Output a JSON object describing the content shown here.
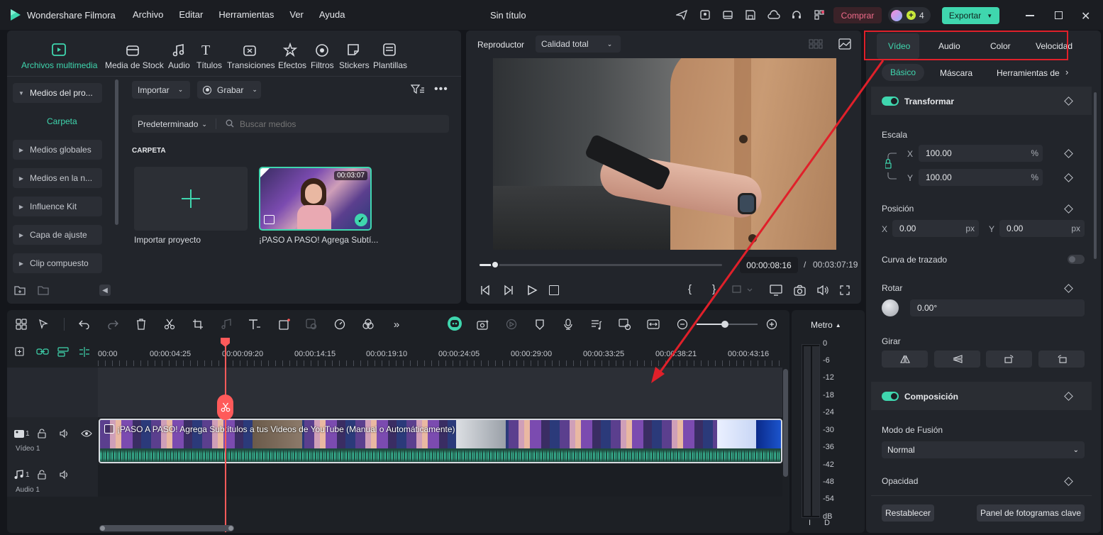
{
  "app": {
    "name": "Wondershare Filmora",
    "project_title": "Sin título"
  },
  "menu": [
    "Archivo",
    "Editar",
    "Herramientas",
    "Ver",
    "Ayuda"
  ],
  "titlebar": {
    "buy_label": "Comprar",
    "credits": "4",
    "export_label": "Exportar"
  },
  "media_tabs": [
    "Archivos multimedia",
    "Media de Stock",
    "Audio",
    "Títulos",
    "Transiciones",
    "Efectos",
    "Filtros",
    "Stickers",
    "Plantillas"
  ],
  "sidebar": {
    "project_media": "Medios del pro...",
    "folder": "Carpeta",
    "items": [
      "Medios globales",
      "Medios en la n...",
      "Influence Kit",
      "Capa de ajuste",
      "Clip compuesto"
    ]
  },
  "media_panel": {
    "import_label": "Importar",
    "record_label": "Grabar",
    "sort_label": "Predeterminado",
    "search_placeholder": "Buscar medios",
    "section_label": "CARPETA",
    "import_project_label": "Importar proyecto",
    "clip_duration": "00:03:07",
    "clip_name": "¡PASO A PASO! Agrega Subtí..."
  },
  "player": {
    "label": "Reproductor",
    "quality": "Calidad total",
    "current_time": "00:00:08:16",
    "separator": "/",
    "total_time": "00:03:07:19",
    "progress": 0.012
  },
  "properties": {
    "tabs": [
      "Vídeo",
      "Audio",
      "Color",
      "Velocidad"
    ],
    "subtabs": [
      "Básico",
      "Máscara",
      "Herramientas de"
    ],
    "transform_label": "Transformar",
    "scale_label": "Escala",
    "scale_x_axis": "X",
    "scale_x": "100.00",
    "scale_y_axis": "Y",
    "scale_y": "100.00",
    "percent": "%",
    "position_label": "Posición",
    "pos_x_axis": "X",
    "pos_x": "0.00",
    "pos_y_axis": "Y",
    "pos_y": "0.00",
    "px": "px",
    "path_curve_label": "Curva de trazado",
    "rotate_label": "Rotar",
    "rotate_value": "0.00°",
    "flip_label": "Girar",
    "composition_label": "Composición",
    "blend_label": "Modo de Fusión",
    "blend_value": "Normal",
    "opacity_label": "Opacidad",
    "reset_label": "Restablecer",
    "keyframe_panel_label": "Panel de fotogramas clave"
  },
  "timeline": {
    "ruler": [
      "00:00",
      "00:00:04:25",
      "00:00:09:20",
      "00:00:14:15",
      "00:00:19:10",
      "00:00:24:05",
      "00:00:29:00",
      "00:00:33:25",
      "00:00:38:21",
      "00:00:43:16"
    ],
    "video_track_num": "1",
    "video_track_label": "Vídeo 1",
    "audio_track_num": "1",
    "audio_track_label": "Audio 1",
    "clip_title": "¡PASO A PASO! Agrega Subtítulos a tus Videos de YouTube (Manual o Automáticamente)"
  },
  "meter": {
    "label": "Metro",
    "scale": [
      "0",
      "-6",
      "-12",
      "-18",
      "-24",
      "-30",
      "-36",
      "-42",
      "-48",
      "-54",
      "dB"
    ],
    "left_channel": "I",
    "right_channel": "D"
  },
  "colors": {
    "accent": "#3fd6ae",
    "highlight_box": "#e0202a",
    "playhead": "#ff5a5a",
    "buy": "#e8476a"
  }
}
